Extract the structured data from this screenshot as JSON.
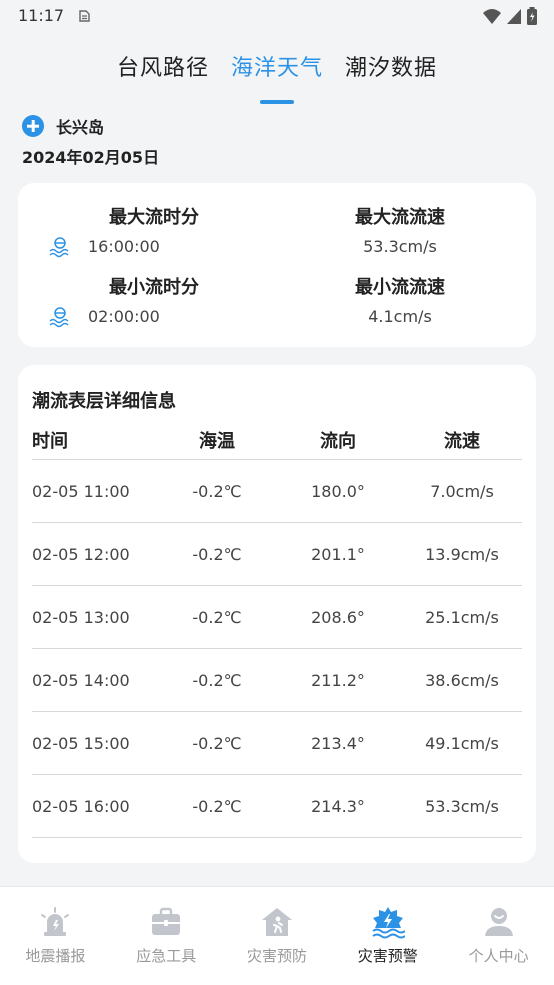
{
  "status_bar": {
    "time": "11:17"
  },
  "tabs": [
    {
      "label": "台风路径",
      "active": false
    },
    {
      "label": "海洋天气",
      "active": true
    },
    {
      "label": "潮汐数据",
      "active": false
    }
  ],
  "location": {
    "name": "长兴岛",
    "date": "2024年02月05日"
  },
  "summary": {
    "max_time_label": "最大流时分",
    "max_time_value": "16:00:00",
    "max_speed_label": "最大流流速",
    "max_speed_value": "53.3cm/s",
    "min_time_label": "最小流时分",
    "min_time_value": "02:00:00",
    "min_speed_label": "最小流流速",
    "min_speed_value": "4.1cm/s"
  },
  "detail": {
    "title": "潮流表层详细信息",
    "headers": [
      "时间",
      "海温",
      "流向",
      "流速"
    ],
    "rows": [
      [
        "02-05 11:00",
        "-0.2℃",
        "180.0°",
        "7.0cm/s"
      ],
      [
        "02-05 12:00",
        "-0.2℃",
        "201.1°",
        "13.9cm/s"
      ],
      [
        "02-05 13:00",
        "-0.2℃",
        "208.6°",
        "25.1cm/s"
      ],
      [
        "02-05 14:00",
        "-0.2℃",
        "211.2°",
        "38.6cm/s"
      ],
      [
        "02-05 15:00",
        "-0.2℃",
        "213.4°",
        "49.1cm/s"
      ],
      [
        "02-05 16:00",
        "-0.2℃",
        "214.3°",
        "53.3cm/s"
      ]
    ]
  },
  "nav": {
    "items": [
      {
        "label": "地震播报",
        "icon": "earthquake-alarm-icon",
        "active": false
      },
      {
        "label": "应急工具",
        "icon": "toolbox-icon",
        "active": false
      },
      {
        "label": "灾害预防",
        "icon": "house-prevention-icon",
        "active": false
      },
      {
        "label": "灾害预警",
        "icon": "disaster-warning-icon",
        "active": true
      },
      {
        "label": "个人中心",
        "icon": "user-icon",
        "active": false
      }
    ]
  },
  "colors": {
    "accent": "#2c92e6",
    "nav_inactive": "#c2c6cc",
    "nav_active": "#2c92e6"
  }
}
